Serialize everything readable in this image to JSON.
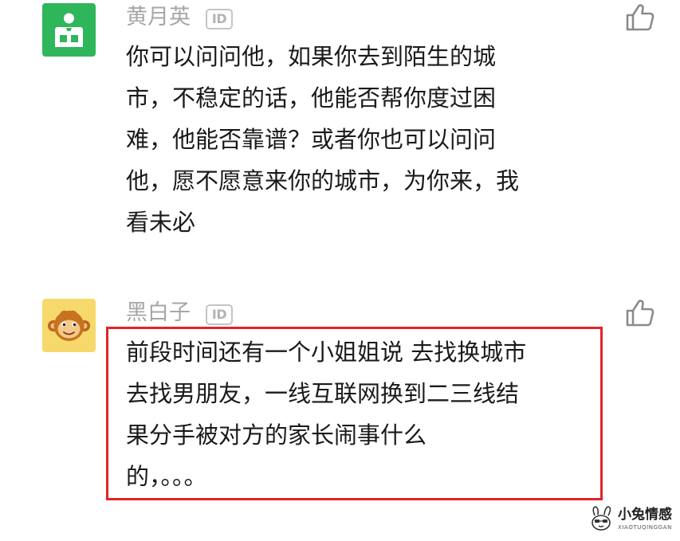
{
  "comments": [
    {
      "username": "黄月英",
      "id_badge": "ID",
      "avatar_color": "#2fb55a",
      "lines": [
        "你可以问问他，如果你去到陌生的城",
        "市，不稳定的话，他能否帮你度过困",
        "难，他能否靠谱？或者你也可以问问",
        "他，愿不愿意来你的城市，为你来，我",
        "看未必"
      ]
    },
    {
      "username": "黑白子",
      "id_badge": "ID",
      "avatar_color": "#f6d96a",
      "lines": [
        "前段时间还有一个小姐姐说 去找换城市",
        "去找男朋友，一线互联网换到二三线结",
        "果分手被对方的家长闹事什么",
        "的，。。。"
      ]
    }
  ],
  "highlight_color": "#e2232a",
  "watermark": {
    "title": "小兔情感",
    "subtitle": "XIAOTUQINGGAN"
  }
}
